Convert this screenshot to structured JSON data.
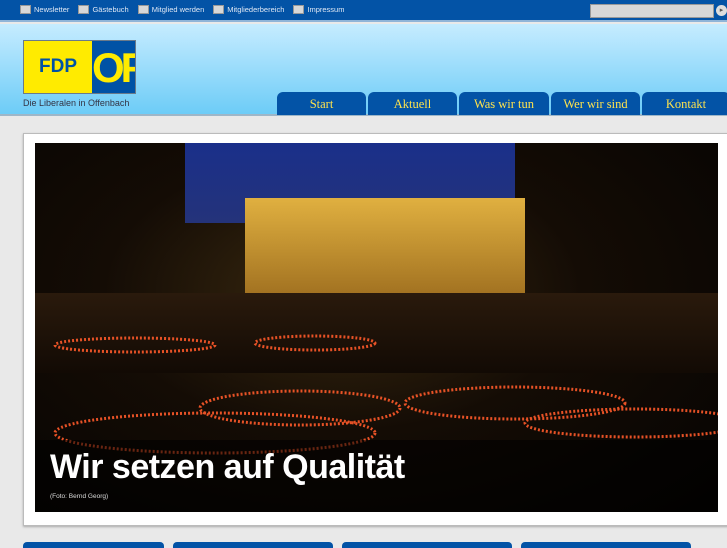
{
  "topbar": {
    "links": [
      {
        "label": "Newsletter",
        "icon": "envelope-icon"
      },
      {
        "label": "Gästebuch",
        "icon": "book-icon"
      },
      {
        "label": "Mitglied werden",
        "icon": "user-icon"
      },
      {
        "label": "Mitgliederbereich",
        "icon": "users-icon"
      },
      {
        "label": "Impressum",
        "icon": "document-icon"
      }
    ],
    "search_value": ""
  },
  "header": {
    "logo_left": "FDP",
    "logo_right": "OF",
    "tagline": "Die Liberalen in Offenbach"
  },
  "nav": [
    {
      "label": "Start"
    },
    {
      "label": "Aktuell"
    },
    {
      "label": "Was wir tun"
    },
    {
      "label": "Wer wir sind"
    },
    {
      "label": "Kontakt"
    }
  ],
  "feature": {
    "headline": "Wir setzen auf Qualität",
    "credit": "(Foto: Bernd Georg)"
  },
  "colors": {
    "brand_blue": "#0353a6",
    "brand_yellow": "#ffeb00"
  }
}
